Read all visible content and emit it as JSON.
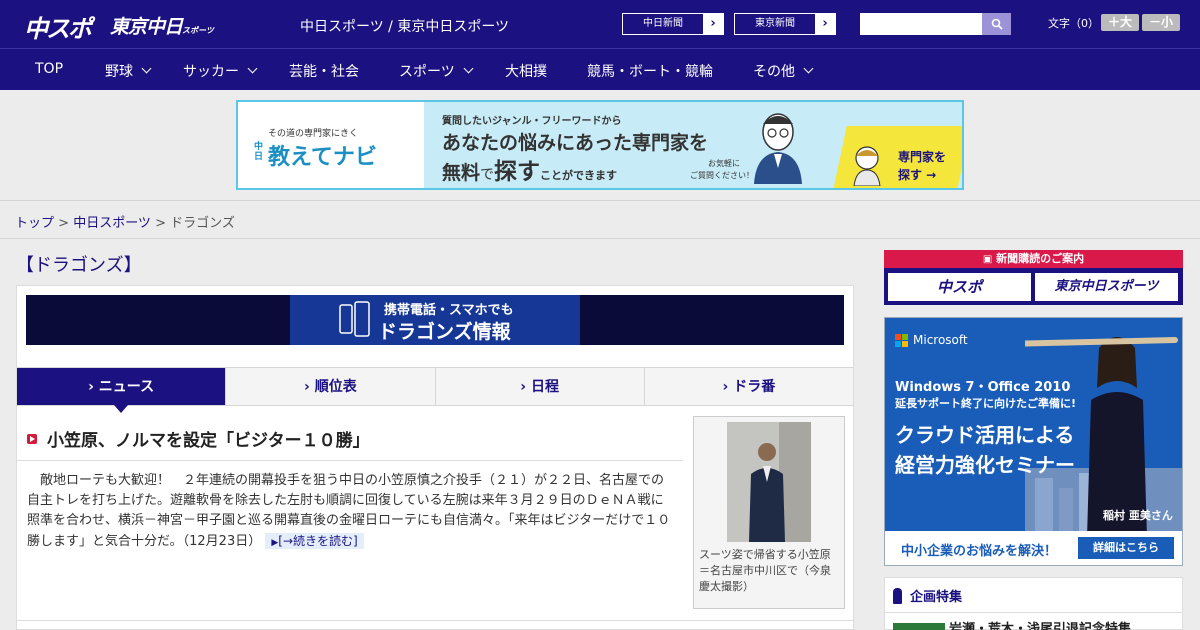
{
  "header": {
    "logo_chunichi": "中スポ",
    "logo_tokyo": "東京中日",
    "logo_tokyo_sub": "スポーツ",
    "site_title": "中日スポーツ / 東京中日スポーツ",
    "ext_link_1": "中日新聞",
    "ext_link_2": "東京新聞",
    "search_placeholder": "",
    "font_size_label": "文字（0）",
    "font_plus": "＋大",
    "font_minus": "－小"
  },
  "nav": {
    "items": [
      "TOP",
      "野球",
      "サッカー",
      "芸能・社会",
      "スポーツ",
      "大相撲",
      "競馬・ボート・競輪",
      "その他"
    ]
  },
  "banner": {
    "brand_tag": "その道の専門家にきく",
    "brand_prefix": "中日",
    "brand_name": "教えてナビ",
    "line1": "質問したいジャンル・フリーワードから",
    "line2": "あなたの悩みにあった専門家を",
    "line3_a": "無料",
    "line3_b": "で",
    "line3_c": "探す",
    "line3_d": "ことができます",
    "line4": "お気軽に",
    "line5": "ご質問ください！",
    "cta_1": "専門家を",
    "cta_2": "探す →"
  },
  "breadcrumb": {
    "top": "トップ",
    "sep1": " > ",
    "chunichi": "中日スポーツ",
    "sep2": " > ",
    "current": "ドラゴンズ"
  },
  "main": {
    "section_title": "【ドラゴンズ】",
    "mobile_banner_1": "携帯電話・スマホでも",
    "mobile_banner_2": "ドラゴンズ情報",
    "tabs": [
      "ニュース",
      "順位表",
      "日程",
      "ドラ番"
    ],
    "article": {
      "headline": "小笠原、ノルマを設定「ビジター１０勝」",
      "body": "　敵地ローテも大歓迎！　２年連続の開幕投手を狙う中日の小笠原慎之介投手（２１）が２２日、名古屋での自主トレを打ち上げた。遊離軟骨を除去した左肘も順調に回復している左腕は来年３月２９日のＤｅＮＡ戦に照準を合わせ、横浜－神宮－甲子園と巡る開幕直後の金曜日ローテにも自信満々。「来年はビジターだけで１０勝します」と気合十分だ。",
      "date": "（12月23日）",
      "more_label": "[→続きを読む]",
      "photo_caption": "スーツ姿で帰省する小笠原＝名古屋市中川区で（今泉慶太撮影）"
    }
  },
  "sidebar": {
    "subscribe_head": "新聞購読のご案内",
    "sub_btn_1": "中スポ",
    "sub_btn_2": "東京中日スポーツ",
    "ad": {
      "brand": "Microsoft",
      "l1": "Windows 7・Office 2010",
      "l2": "延長サポート終了に向けたご準備に!",
      "l3a": "クラウド活用による",
      "l3b": "経営力強化セミナー",
      "person": "稲村 亜美さん",
      "foot": "中小企業のお悩みを解決！",
      "foot_btn": "詳細はこちら"
    },
    "kikaku_head": "企画特集",
    "kikaku_item": "岩瀬・荒木・浅尾引退記念特集"
  }
}
